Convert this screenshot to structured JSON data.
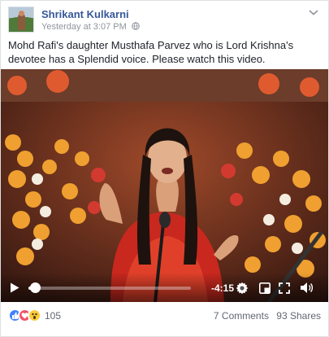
{
  "post": {
    "author": "Shrikant Kulkarni",
    "timestamp": "Yesterday at 3:07 PM",
    "text": "Mohd Rafi's daughter Musthafa Parvez who is Lord Krishna's devotee has a Splendid voice. Please watch this video."
  },
  "video": {
    "time_remaining": "-4:15",
    "progress_fraction": 0.04
  },
  "footer": {
    "reaction_count": "105",
    "comments": "7 Comments",
    "shares": "93 Shares"
  },
  "icons": {
    "avatar": "avatar",
    "options": "chevron-down-icon",
    "privacy": "globe-icon",
    "play": "play-icon",
    "settings": "gear-icon",
    "pip": "picture-in-picture-icon",
    "fullscreen": "fullscreen-icon",
    "volume": "volume-icon",
    "reactions": [
      "like-icon",
      "love-icon",
      "wow-icon"
    ]
  },
  "colors": {
    "link": "#365899",
    "like": "#4080ff",
    "love": "#f25268",
    "wow": "#fbcc3c"
  }
}
